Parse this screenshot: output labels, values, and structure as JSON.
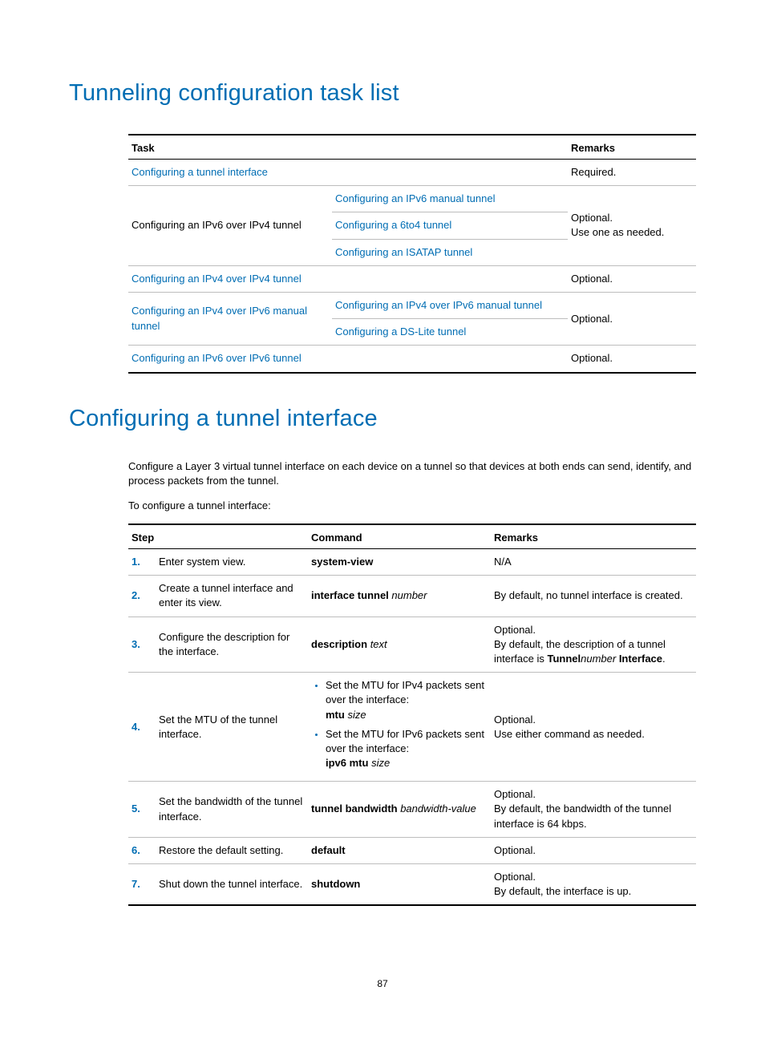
{
  "h1a": "Tunneling configuration task list",
  "h1b": "Configuring a tunnel interface",
  "para1": "Configure a Layer 3 virtual tunnel interface on each device on a tunnel so that devices at both ends can send, identify, and process packets from the tunnel.",
  "para2": "To configure a tunnel interface:",
  "pagenum": "87",
  "t1": {
    "h1": "Task",
    "h2": "Remarks",
    "r1c1": "Configuring a tunnel interface",
    "r1c3": "Required.",
    "r2c1": "Configuring an IPv6 over IPv4 tunnel",
    "r2a": "Configuring an IPv6 manual tunnel",
    "r2b": "Configuring a 6to4 tunnel",
    "r2c": "Configuring an ISATAP tunnel",
    "r2rem1": "Optional.",
    "r2rem2": "Use one as needed.",
    "r3c1": "Configuring an IPv4 over IPv4 tunnel",
    "r3c3": "Optional.",
    "r4c1": "Configuring an IPv4 over IPv6 manual tunnel",
    "r4a": "Configuring an IPv4 over IPv6 manual tunnel",
    "r4b": "Configuring a DS-Lite tunnel",
    "r4rem": "Optional.",
    "r5c1": "Configuring an IPv6 over IPv6 tunnel",
    "r5c3": "Optional."
  },
  "t2": {
    "h1": "Step",
    "h2": "Command",
    "h3": "Remarks",
    "s1n": "1.",
    "s1t": "Enter system view.",
    "s1c": "system-view",
    "s1r": "N/A",
    "s2n": "2.",
    "s2t": "Create a tunnel interface and enter its view.",
    "s2c_b": "interface tunnel",
    "s2c_i": " number",
    "s2r": "By default, no tunnel interface is created.",
    "s3n": "3.",
    "s3t": "Configure the description for the interface.",
    "s3c_b": "description",
    "s3c_i": " text",
    "s3r1": "Optional.",
    "s3r2a": "By default, the description of a tunnel interface is ",
    "s3r2b": "Tunnel",
    "s3r2c": "number",
    "s3r2d": " Interface",
    "s3r2e": ".",
    "s4n": "4.",
    "s4t": "Set the MTU of the tunnel interface.",
    "s4l1a": "Set the MTU for IPv4 packets sent over the interface:",
    "s4l1b": "mtu",
    "s4l1c": " size",
    "s4l2a": "Set the MTU for IPv6 packets sent over the interface:",
    "s4l2b": "ipv6 mtu",
    "s4l2c": " size",
    "s4r1": "Optional.",
    "s4r2": "Use either command as needed.",
    "s5n": "5.",
    "s5t": "Set the bandwidth of the tunnel interface.",
    "s5c_b": "tunnel bandwidth",
    "s5c_i": " bandwidth-value",
    "s5r1": "Optional.",
    "s5r2": "By default, the bandwidth of the tunnel interface is 64 kbps.",
    "s6n": "6.",
    "s6t": "Restore the default setting.",
    "s6c": "default",
    "s6r": "Optional.",
    "s7n": "7.",
    "s7t": "Shut down the tunnel interface.",
    "s7c": "shutdown",
    "s7r1": "Optional.",
    "s7r2": "By default, the interface is up."
  }
}
